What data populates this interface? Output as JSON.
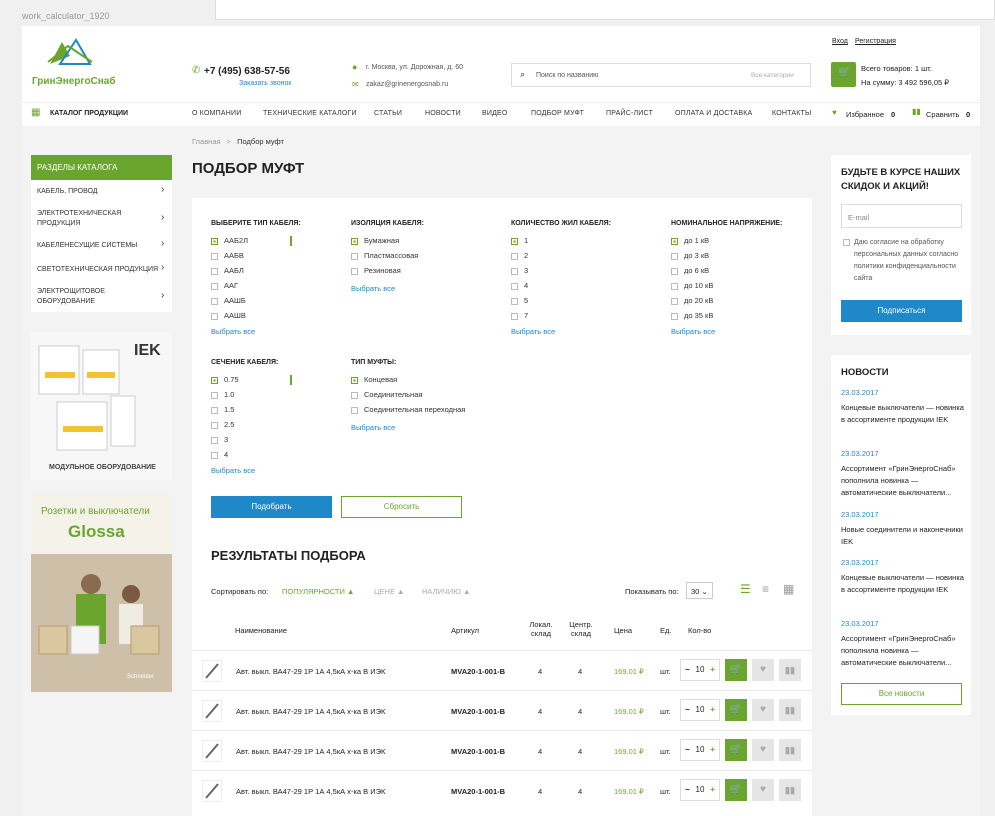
{
  "window_label": "work_calculator_1920",
  "header": {
    "logo": "ГринЭнергоСнаб",
    "phone": "+7 (495) 638-57-56",
    "callback": "Заказать звонок",
    "address": "г. Москва, ул. Дорожная, д. 60",
    "email": "zakaz@grinenergosnab.ru",
    "search_placeholder": "Поиск по названию",
    "search_scope": "Все категории",
    "login": "Вход",
    "register": "Регистрация",
    "cart_items": "Всего товаров: 1 шт.",
    "cart_sum": "На сумму: 3 492 596,05 ₽"
  },
  "nav": {
    "catalog": "КАТАЛОГ ПРОДУКЦИИ",
    "items": [
      "О КОМПАНИИ",
      "ТЕХНИЧЕСКИЕ КАТАЛОГИ",
      "СТАТЬИ",
      "НОВОСТИ",
      "ВИДЕО",
      "ПОДБОР МУФТ",
      "ПРАЙС-ЛИСТ",
      "ОПЛАТА И ДОСТАВКА",
      "КОНТАКТЫ"
    ],
    "favorites": "Избранное",
    "favorites_count": "0",
    "compare": "Сравнить",
    "compare_count": "0"
  },
  "breadcrumb": {
    "home": "Главная",
    "sep": ">",
    "current": "Подбор муфт"
  },
  "sidebar": {
    "title": "РАЗДЕЛЫ КАТАЛОГА",
    "items": [
      "КАБЕЛЬ, ПРОВОД",
      "ЭЛЕКТРОТЕХНИЧЕСКАЯ ПРОДУКЦИЯ",
      "КАБЕЛЕНЕСУЩИЕ СИСТЕМЫ",
      "СВЕТОТЕХНИЧЕСКАЯ ПРОДУКЦИЯ",
      "ЭЛЕКТРОЩИТОВОЕ ОБОРУДОВАНИЕ"
    ],
    "promo1_brand": "IEK",
    "promo1_caption": "МОДУЛЬНОЕ ОБОРУДОВАНИЕ",
    "promo2_title": "Розетки и выключатели",
    "promo2_brand": "Glossa",
    "promo2_logo": "Schneider"
  },
  "page": {
    "title": "ПОДБОР МУФТ",
    "results_title": "РЕЗУЛЬТАТЫ ПОДБОРА"
  },
  "filters": {
    "cable_type": {
      "label": "ВЫБЕРИТЕ ТИП КАБЕЛЯ:",
      "options": [
        "ААБ2Л",
        "ААБВ",
        "ААБЛ",
        "ААГ",
        "ААШБ",
        "ААШВ"
      ]
    },
    "insulation": {
      "label": "ИЗОЛЯЦИЯ КАБЕЛЯ:",
      "options": [
        "Бумажная",
        "Пластмассовая",
        "Резиновая"
      ]
    },
    "cores": {
      "label": "КОЛИЧЕСТВО ЖИЛ  КАБЕЛЯ:",
      "options": [
        "1",
        "2",
        "3",
        "4",
        "5",
        "7"
      ]
    },
    "voltage": {
      "label": "НОМИНАЛЬНОЕ НАПРЯЖЕНИЕ:",
      "options": [
        "до 1 кВ",
        "до 3 кВ",
        "до 6 кВ",
        "до 10 кВ",
        "до 20 кВ",
        "до 35 кВ"
      ]
    },
    "section": {
      "label": "СЕЧЕНИЕ КАБЕЛЯ:",
      "options": [
        "0.75",
        "1.0",
        "1.5",
        "2.5",
        "3",
        "4"
      ]
    },
    "coupling": {
      "label": "ТИП МУФТЫ:",
      "options": [
        "Концевая",
        "Соединительная",
        "Соединительная переходная"
      ]
    },
    "select_all": "Выбрать все",
    "apply": "Подобрать",
    "reset": "Сбросить"
  },
  "sort": {
    "label": "Сортировать по:",
    "popularity": "ПОПУЛЯРНОСТИ ▲",
    "price": "ЦЕНЕ ▲",
    "availability": "НАЛИЧИЮ ▲",
    "show_label": "Показывать по:",
    "show_value": "30"
  },
  "table": {
    "headers": {
      "name": "Наименование",
      "article": "Артикул",
      "local": "Локал. склад",
      "central": "Центр. склад",
      "price": "Цена",
      "unit": "Ед.",
      "qty": "Кол-во"
    },
    "rows": [
      {
        "name": "Авт. выкл. ВА47-29 1Р 1А 4,5кА х-ка В ИЭК",
        "article": "MVA20-1-001-B",
        "local": "4",
        "central": "4",
        "price": "169.01 ₽",
        "unit": "шт.",
        "qty": "10"
      },
      {
        "name": "Авт. выкл. ВА47-29 1Р 1А 4,5кА х-ка В ИЭК",
        "article": "MVA20-1-001-B",
        "local": "4",
        "central": "4",
        "price": "169.01 ₽",
        "unit": "шт.",
        "qty": "10"
      },
      {
        "name": "Авт. выкл. ВА47-29 1Р 1А 4,5кА х-ка В ИЭК",
        "article": "MVA20-1-001-B",
        "local": "4",
        "central": "4",
        "price": "169.01 ₽",
        "unit": "шт.",
        "qty": "10"
      },
      {
        "name": "Авт. выкл. ВА47-29 1Р 1А 4,5кА х-ка В ИЭК",
        "article": "MVA20-1-001-B",
        "local": "4",
        "central": "4",
        "price": "169.01 ₽",
        "unit": "шт.",
        "qty": "10"
      }
    ]
  },
  "subscribe": {
    "title": "БУДЬТЕ В КУРСЕ НАШИХ СКИДОК И АКЦИЙ!",
    "email_placeholder": "E-mail",
    "consent": "Даю согласие на обработку персональных данных согласно политики конфиденциальности сайта",
    "button": "Подписаться"
  },
  "news": {
    "title": "НОВОСТИ",
    "items": [
      {
        "date": "23.03.2017",
        "text": "Концевые выключатели — новинка в ассортименте продукции IEK"
      },
      {
        "date": "23.03.2017",
        "text": "Ассортимент «ГринЭнергоСнаб» пополнила новинка — автоматические выключатели..."
      },
      {
        "date": "23.03.2017",
        "text": "Новые соединители и наконечники IEK"
      },
      {
        "date": "23.03.2017",
        "text": "Концевые выключатели — новинка в ассортименте продукции IEK"
      },
      {
        "date": "23.03.2017",
        "text": "Ассортимент «ГринЭнергоСнаб» пополнила новинка — автоматические выключатели..."
      }
    ],
    "all": "Все новости"
  }
}
